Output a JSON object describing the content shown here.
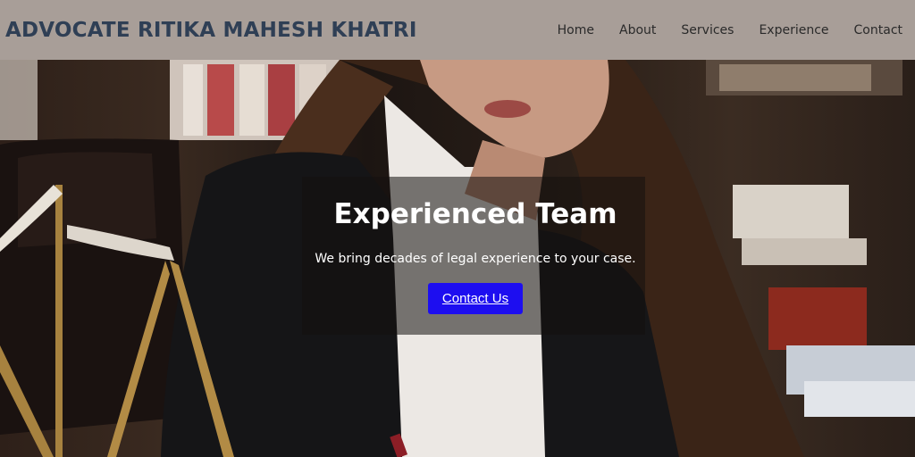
{
  "header": {
    "brand": "ADVOCATE RITIKA MAHESH KHATRI",
    "nav": [
      {
        "label": "Home"
      },
      {
        "label": "About"
      },
      {
        "label": "Services"
      },
      {
        "label": "Experience"
      },
      {
        "label": "Contact"
      }
    ]
  },
  "hero": {
    "image_icon": "lawyer-photo-with-scales",
    "title": "Experienced Team",
    "subtitle": "We bring decades of legal experience to your case.",
    "cta_label": "Contact Us"
  },
  "colors": {
    "navbar_bg": "#a89e98",
    "brand_text": "#2f3f55",
    "cta_bg": "#1d0ef0",
    "hero_text": "#ffffff"
  }
}
